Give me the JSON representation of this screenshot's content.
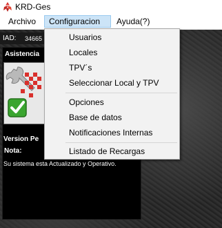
{
  "window": {
    "title": "KRD-Ges"
  },
  "menubar": {
    "items": [
      "Archivo",
      "Configuracion",
      "Ayuda(?)"
    ],
    "active": "Configuracion"
  },
  "dropdown": {
    "group1": [
      "Usuarios",
      "Locales",
      "TPV´s",
      "Seleccionar Local y TPV"
    ],
    "group2": [
      "Opciones",
      "Base de datos",
      "Notificaciones Internas"
    ],
    "group3": [
      "Listado de Recargas"
    ]
  },
  "panel": {
    "iad_label": "IAD:",
    "iad_value": "34665",
    "title": "Asistencia",
    "version_label": "Version Pe",
    "nota_label": "Nota:",
    "status_message": "Su sistema esta Actualizado y Operativo."
  },
  "colors": {
    "menu_highlight": "#cce4f7",
    "menu_highlight_border": "#99c9ef",
    "checkmark_green": "#3aa52f",
    "logo_red": "#d9302c"
  }
}
